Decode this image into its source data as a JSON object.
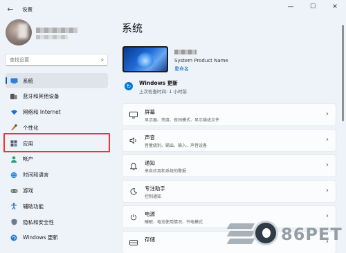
{
  "window": {
    "title": "设置",
    "back_icon": "back-arrow-icon",
    "controls": [
      "minimize",
      "maximize",
      "close"
    ]
  },
  "sidebar": {
    "search_placeholder": "查找设置",
    "items": [
      {
        "label": "系统",
        "icon": "system-icon",
        "active": true
      },
      {
        "label": "蓝牙和其他设备",
        "icon": "bluetooth-icon"
      },
      {
        "label": "网络和 Internet",
        "icon": "wifi-icon"
      },
      {
        "label": "个性化",
        "icon": "personalization-icon"
      },
      {
        "label": "应用",
        "icon": "apps-icon",
        "highlighted": true
      },
      {
        "label": "帐户",
        "icon": "account-icon"
      },
      {
        "label": "时间和语言",
        "icon": "globe-icon"
      },
      {
        "label": "游戏",
        "icon": "gaming-icon"
      },
      {
        "label": "辅助功能",
        "icon": "accessibility-icon"
      },
      {
        "label": "隐私和安全性",
        "icon": "shield-icon"
      },
      {
        "label": "Windows 更新",
        "icon": "update-icon"
      }
    ]
  },
  "main": {
    "title": "系统",
    "device": {
      "model": "System Product Name",
      "rename_label": "重命名"
    },
    "windows_update": {
      "title": "Windows 更新",
      "subtitle": "上次检查时间: 1 小时前"
    },
    "cards": [
      {
        "title": "屏幕",
        "subtitle": "显示器、亮度、夜间模式、显示描述文件",
        "icon": "monitor-icon"
      },
      {
        "title": "声音",
        "subtitle": "音量级别、输出、输入、声音设备",
        "icon": "speaker-icon"
      },
      {
        "title": "通知",
        "subtitle": "来自应用和系统的警报",
        "icon": "bell-icon"
      },
      {
        "title": "专注助手",
        "subtitle": "控制通知",
        "icon": "moon-icon"
      },
      {
        "title": "电源",
        "subtitle": "睡眠、电池使用情况、节电模式",
        "icon": "power-icon"
      },
      {
        "title": "存储",
        "subtitle": "",
        "icon": "storage-icon"
      }
    ]
  },
  "watermark": {
    "text": "86PET"
  },
  "colors": {
    "accent": "#0067c0",
    "highlight": "#e53935",
    "background": "#eef2f9"
  }
}
